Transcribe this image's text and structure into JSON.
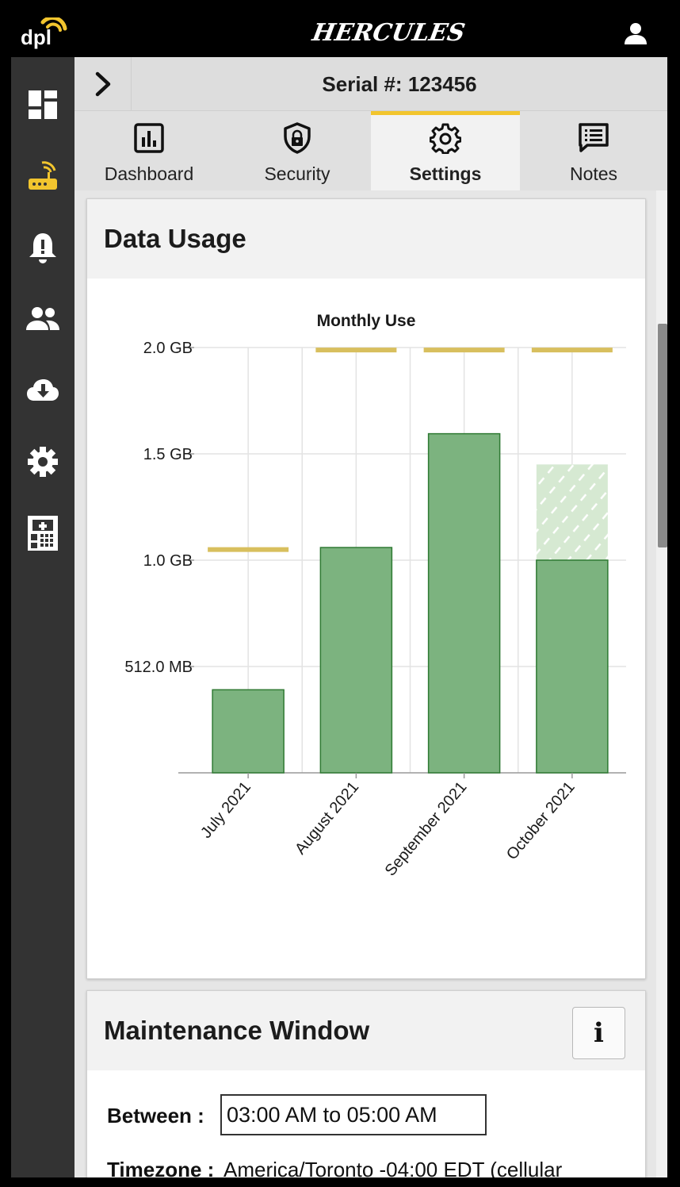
{
  "header": {
    "logo_text": "dpl",
    "brand": "HERCULES",
    "user_icon": "user-icon"
  },
  "sidebar": {
    "items": [
      {
        "icon": "dashboard-grid-icon",
        "active": false
      },
      {
        "icon": "router-wifi-icon",
        "active": true
      },
      {
        "icon": "alert-bell-icon",
        "active": false
      },
      {
        "icon": "users-icon",
        "active": false
      },
      {
        "icon": "cloud-download-icon",
        "active": false
      },
      {
        "icon": "gear-icon",
        "active": false
      },
      {
        "icon": "calculator-icon",
        "active": false
      }
    ],
    "active_color": "#f2c52e"
  },
  "serial": {
    "label": "Serial #: 123456",
    "expand_icon": "chevron-right-icon"
  },
  "tabs": [
    {
      "label": "Dashboard",
      "icon": "bar-chart-icon",
      "active": false
    },
    {
      "label": "Security",
      "icon": "shield-lock-icon",
      "active": false
    },
    {
      "label": "Settings",
      "icon": "gear-icon",
      "active": true
    },
    {
      "label": "Notes",
      "icon": "notes-icon",
      "active": false
    }
  ],
  "data_usage": {
    "title": "Data Usage"
  },
  "chart_data": {
    "type": "bar",
    "title": "Monthly Use",
    "categories": [
      "July 2021",
      "August 2021",
      "September 2021",
      "October 2021"
    ],
    "unit": "MB",
    "series": [
      {
        "values": [
          400,
          1085,
          1633,
          1024
        ],
        "color": "#7cb37f"
      },
      {
        "values": [
          null,
          null,
          null,
          1485
        ],
        "color": "#d6e9d2",
        "style": "projected-hatched"
      },
      {
        "values": [
          1075,
          2036,
          2036,
          2036
        ],
        "color": "#d8bf5e",
        "style": "limit-line"
      }
    ],
    "yticks": [
      {
        "value": 512,
        "label": "512.0 MB"
      },
      {
        "value": 1024,
        "label": "1.0 GB"
      },
      {
        "value": 1536,
        "label": "1.5 GB"
      },
      {
        "value": 2048,
        "label": "2.0 GB"
      }
    ],
    "ylim": [
      0,
      2048
    ],
    "xlabel": "",
    "ylabel": "",
    "grid": true
  },
  "maintenance": {
    "title": "Maintenance Window",
    "info_label": "i",
    "between_label": "Between :",
    "window_value": "03:00 AM to 05:00 AM",
    "timezone_label": "Timezone :",
    "timezone_value": "America/Toronto -04:00 EDT (cellular"
  }
}
